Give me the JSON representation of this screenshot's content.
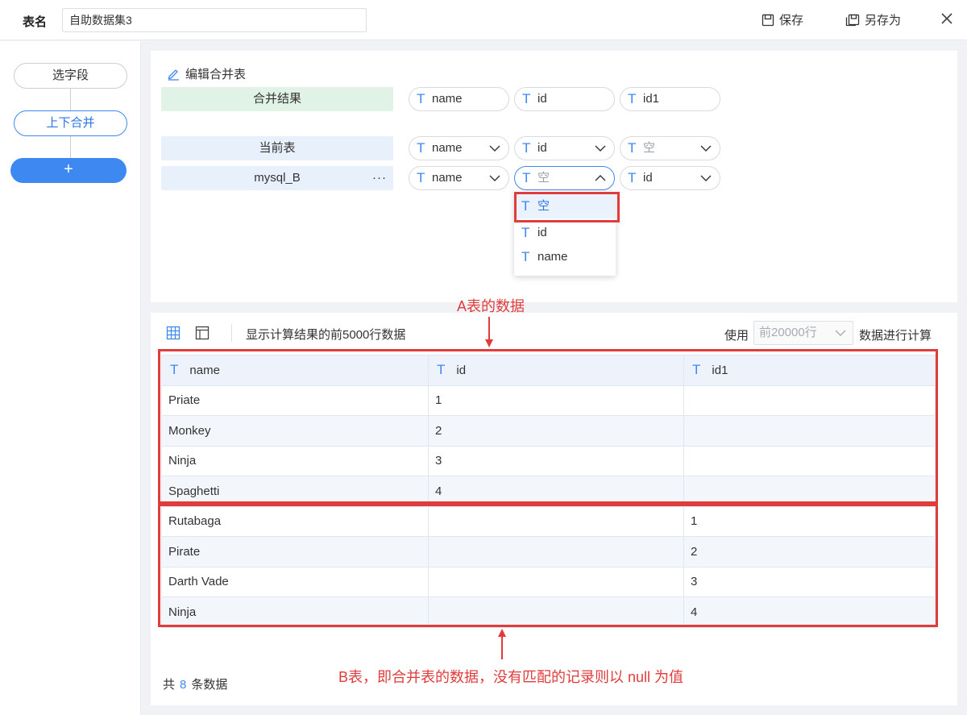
{
  "topbar": {
    "name_label": "表名",
    "name_value": "自助数据集3",
    "save_label": "保存",
    "saveas_label": "另存为"
  },
  "flow": {
    "nodes": [
      "选字段",
      "上下合并"
    ],
    "add_label": "+"
  },
  "union": {
    "title": "编辑合并表",
    "rows": [
      {
        "label": "合并结果",
        "fields": [
          "name",
          "id",
          "id1"
        ]
      },
      {
        "label": "当前表",
        "fields": [
          "name",
          "id",
          "空"
        ]
      },
      {
        "label": "mysql_B",
        "fields": [
          "name",
          "空",
          "id"
        ],
        "more": "···"
      }
    ],
    "dropdown_options": [
      "空",
      "id",
      "name"
    ],
    "dropdown_selected": "空"
  },
  "preview": {
    "note": "显示计算结果的前5000行数据",
    "use_label": "使用",
    "row_limit": "前20000行",
    "use_suffix": "数据进行计算",
    "columns": [
      "name",
      "id",
      "id1"
    ],
    "rows": [
      [
        "Priate",
        "1",
        ""
      ],
      [
        "Monkey",
        "2",
        ""
      ],
      [
        "Ninja",
        "3",
        ""
      ],
      [
        "Spaghetti",
        "4",
        ""
      ],
      [
        "Rutabaga",
        "",
        "1"
      ],
      [
        "Pirate",
        "",
        "2"
      ],
      [
        "Darth Vade",
        "",
        "3"
      ],
      [
        "Ninja",
        "",
        "4"
      ]
    ],
    "total_prefix": "共",
    "total_count": "8",
    "total_suffix": "条数据"
  },
  "annotations": {
    "a_label": "A表的数据",
    "b_label": "B表，即合并表的数据，没有匹配的记录则以 null 为值",
    "color": "#e03c3c"
  },
  "colors": {
    "accent": "#3e88f2",
    "merge_result_bg": "#e1f3e7",
    "row_label_bg": "#e8f0fb"
  }
}
